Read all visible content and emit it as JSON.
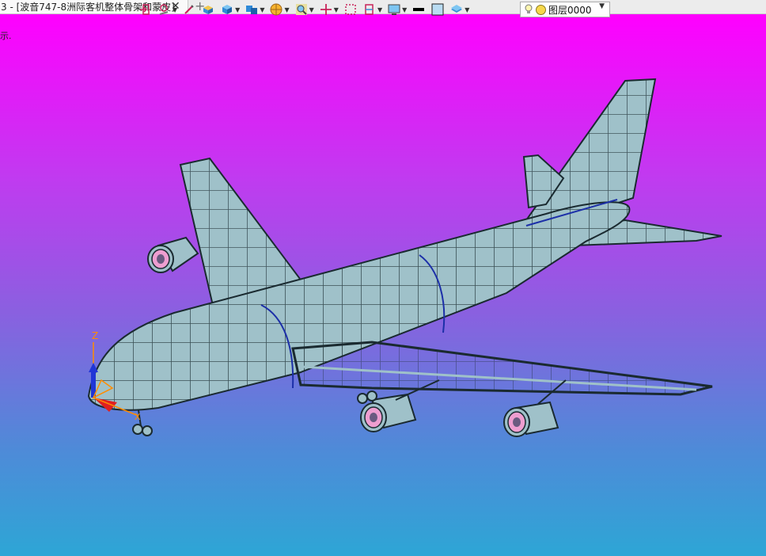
{
  "tab": {
    "title": "3 - [波音747-8洲际客机整体骨架和蒙皮]",
    "close": "✕",
    "add": "+"
  },
  "viewport": {
    "hint": "示.",
    "colors": {
      "top": "#ff00ff",
      "bottom": "#2da6d6"
    }
  },
  "layer": {
    "value": "图层0000"
  },
  "axes": {
    "z": "Z",
    "x": "X"
  },
  "toolbar": {
    "icons": [
      "exit-icon",
      "sketch-tools-icon",
      "pencil-icon",
      "box-icon",
      "cube-icon",
      "view-cube-icon",
      "render-mode-icon",
      "zoom-icon",
      "move-icon",
      "fit-icon",
      "section-icon",
      "display-icon",
      "line-color-icon",
      "fill-color-icon",
      "layer-stack-icon"
    ]
  },
  "model": {
    "color": "#9fc1c9",
    "edge_color": "#1a2a30"
  }
}
